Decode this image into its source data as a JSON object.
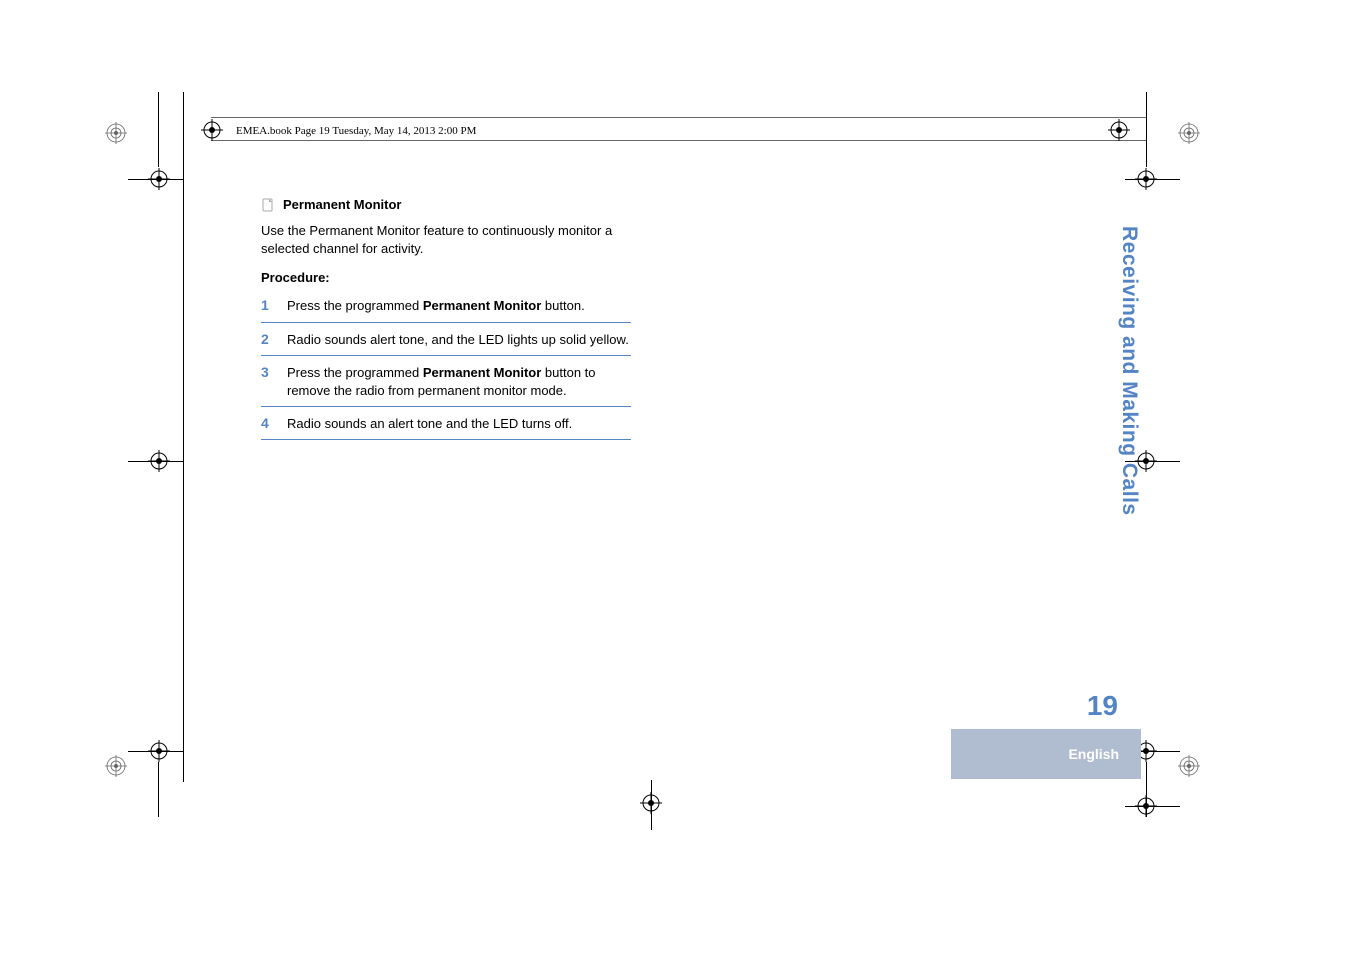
{
  "header": {
    "text": "EMEA.book  Page 19  Tuesday, May 14, 2013  2:00 PM"
  },
  "section": {
    "title": "Permanent Monitor",
    "description": "Use the Permanent Monitor feature to continuously monitor a selected channel for activity."
  },
  "procedure": {
    "label": "Procedure:",
    "steps": [
      {
        "num": "1",
        "pre": "Press the programmed ",
        "bold": "Permanent Monitor",
        "post": " button."
      },
      {
        "num": "2",
        "pre": "Radio sounds alert tone, and the LED lights up solid yellow.",
        "bold": "",
        "post": ""
      },
      {
        "num": "3",
        "pre": "Press the programmed ",
        "bold": "Permanent Monitor",
        "post": " button to remove the radio from permanent monitor mode."
      },
      {
        "num": "4",
        "pre": "Radio sounds an alert tone and the LED turns off.",
        "bold": "",
        "post": ""
      }
    ]
  },
  "sidebar": {
    "chapter": "Receiving and Making Calls"
  },
  "footer": {
    "page_number": "19",
    "language": "English"
  }
}
